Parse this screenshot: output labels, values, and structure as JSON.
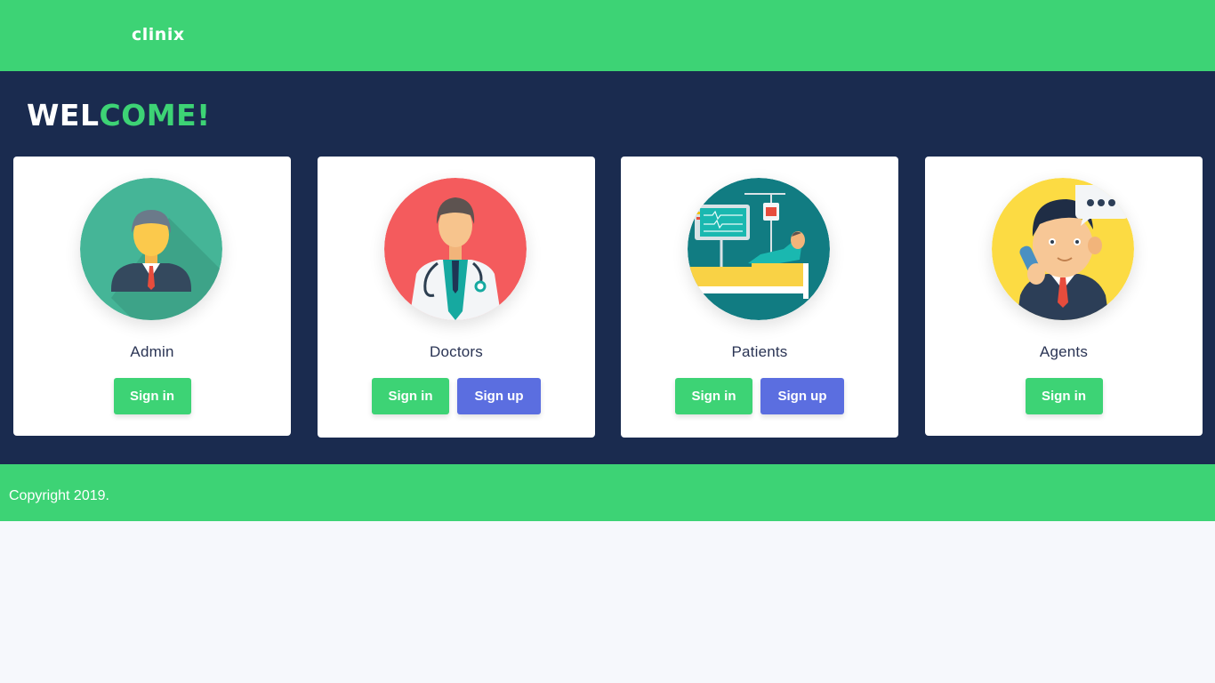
{
  "header": {
    "logo_text": "clinix"
  },
  "hero": {
    "welcome_part1": "WEL",
    "welcome_part2": "COME!"
  },
  "cards": [
    {
      "title": "Admin",
      "signin_label": "Sign in"
    },
    {
      "title": "Doctors",
      "signin_label": "Sign in",
      "signup_label": "Sign up"
    },
    {
      "title": "Patients",
      "signin_label": "Sign in",
      "signup_label": "Sign up"
    },
    {
      "title": "Agents",
      "signin_label": "Sign in"
    }
  ],
  "footer": {
    "copyright": "Copyright 2019."
  },
  "colors": {
    "brand_green": "#3dd375",
    "hero_navy": "#1a2b4f",
    "signup_blue": "#5b6ee0",
    "page_bg": "#f6f8fc"
  },
  "icons": [
    "admin-avatar-icon",
    "doctor-avatar-icon",
    "patient-avatar-icon",
    "agent-avatar-icon"
  ]
}
